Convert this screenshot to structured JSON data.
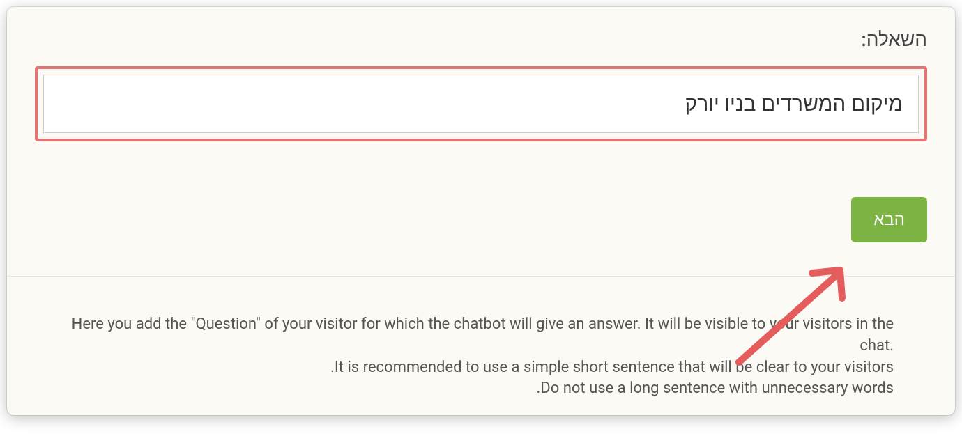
{
  "form": {
    "question_label": "השאלה:",
    "question_value": "מיקום המשרדים בניו יורק",
    "next_button_label": "הבא"
  },
  "help": {
    "line1": "Here you add the \"Question\" of your visitor for which the chatbot will give an answer. It will be visible to your visitors in the chat.",
    "line2": ".It is recommended to use a simple short sentence that will be clear to your visitors",
    "line3": ".Do not use a long sentence with unnecessary words"
  },
  "annotation": {
    "highlight_color": "#e57373",
    "arrow_color": "#e55c5c"
  }
}
